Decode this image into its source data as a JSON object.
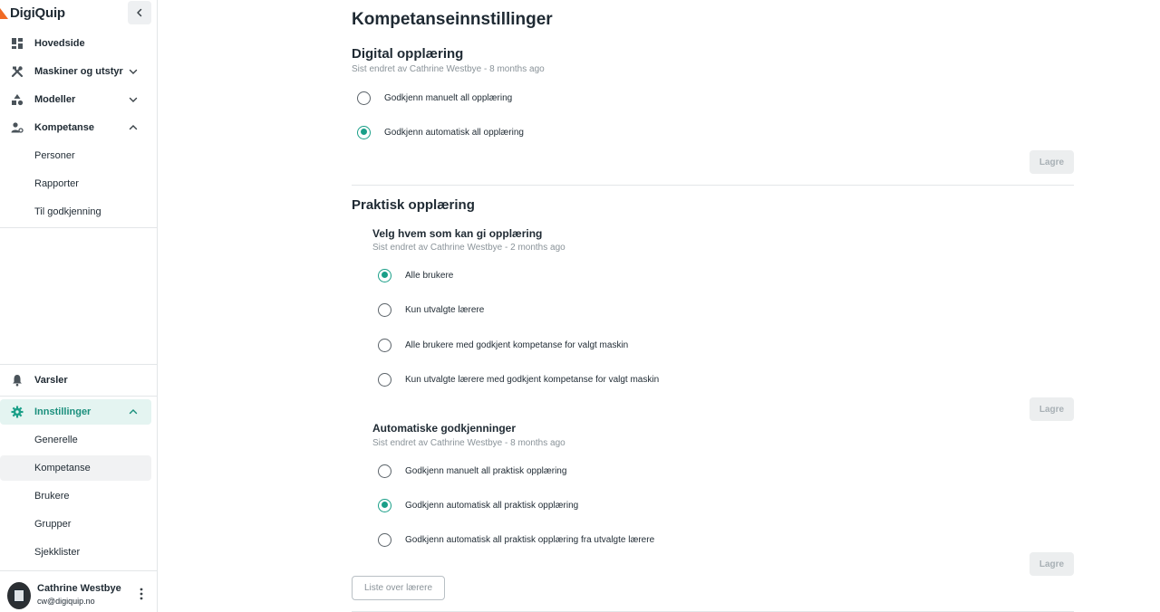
{
  "app": {
    "logo_text": "DigiQuip",
    "brand_color": "#f06a25",
    "accent_color": "#1a9f88"
  },
  "sidebar": {
    "nav": [
      {
        "label": "Hovedside",
        "icon": "dashboard-icon"
      },
      {
        "label": "Maskiner og utstyr",
        "icon": "tools-icon",
        "chevron": "down"
      },
      {
        "label": "Modeller",
        "icon": "shapes-icon",
        "chevron": "down"
      },
      {
        "label": "Kompetanse",
        "icon": "person-gear-icon",
        "chevron": "up"
      }
    ],
    "kompetanse_sub": [
      "Personer",
      "Rapporter",
      "Til godkjenning"
    ],
    "varsler": {
      "label": "Varsler",
      "icon": "bell-icon"
    },
    "innstillinger": {
      "label": "Innstillinger",
      "icon": "gear-icon",
      "chevron": "up"
    },
    "innstillinger_sub": [
      "Generelle",
      "Kompetanse",
      "Brukere",
      "Grupper",
      "Sjekklister"
    ],
    "active_sub": "Kompetanse"
  },
  "user": {
    "name": "Cathrine Westbye",
    "email": "cw@digiquip.no"
  },
  "main": {
    "page_title": "Kompetanseinnstillinger",
    "digital": {
      "title": "Digital opplæring",
      "meta": "Sist endret av Cathrine Westbye - 8 months ago",
      "options": [
        {
          "label": "Godkjenn manuelt all opplæring",
          "checked": false
        },
        {
          "label": "Godkjenn automatisk all opplæring",
          "checked": true
        }
      ],
      "save_label": "Lagre"
    },
    "praktisk": {
      "title": "Praktisk opplæring",
      "who": {
        "title": "Velg hvem som kan gi opplæring",
        "meta": "Sist endret av Cathrine Westbye - 2 months ago",
        "options": [
          {
            "label": "Alle brukere",
            "checked": true
          },
          {
            "label": "Kun utvalgte lærere",
            "checked": false
          },
          {
            "label": "Alle brukere med godkjent kompetanse for valgt maskin",
            "checked": false
          },
          {
            "label": "Kun utvalgte lærere med godkjent kompetanse for valgt maskin",
            "checked": false
          }
        ],
        "save_label": "Lagre"
      },
      "auto": {
        "title": "Automatiske godkjenninger",
        "meta": "Sist endret av Cathrine Westbye - 8 months ago",
        "options": [
          {
            "label": "Godkjenn manuelt all praktisk opplæring",
            "checked": false
          },
          {
            "label": "Godkjenn automatisk all praktisk opplæring",
            "checked": true
          },
          {
            "label": "Godkjenn automatisk all praktisk opplæring fra utvalgte lærere",
            "checked": false
          }
        ],
        "save_label": "Lagre"
      },
      "teacher_list_label": "Liste over lærere"
    }
  }
}
